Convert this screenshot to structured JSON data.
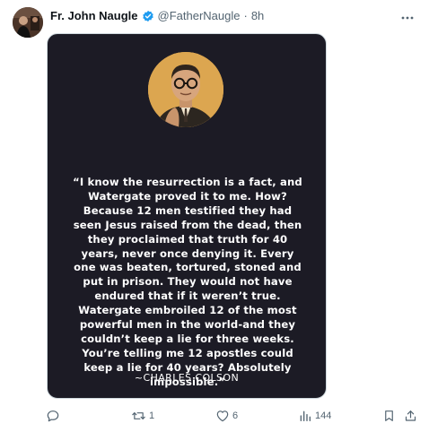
{
  "author": {
    "name": "Fr. John Naugle",
    "handle": "@FatherNaugle",
    "separator": "·",
    "time": "8h"
  },
  "media": {
    "quote": "“I know the resurrection is a fact, and\nWatergate proved it to me. How?\nBecause 12 men testified they had\nseen Jesus raised from the dead, then\nthey proclaimed that truth for 40\nyears, never once denying it. Every\none was beaten, tortured, stoned and\nput in prison. They would not have\nendured that if it weren’t true.\nWatergate embroiled 12 of the most\npowerful men in the world-and they\ncouldn’t keep a lie for three weeks.\nYou’re telling me 12 apostles could\nkeep a lie for 40 years? Absolutely\nimpossible.”",
    "attribution": "~CHARLES COLSON"
  },
  "actions": {
    "reply_count": "",
    "retweet_count": "1",
    "like_count": "6",
    "view_count": "144"
  },
  "icons": {
    "reply": "reply-icon",
    "retweet": "retweet-icon",
    "like": "heart-icon",
    "views": "views-icon",
    "bookmark": "bookmark-icon",
    "share": "share-icon",
    "more": "more-icon",
    "verified": "verified-badge-icon"
  },
  "colors": {
    "text": "#0f1419",
    "secondary": "#536471",
    "verified": "#1d9bf0",
    "card_bg": "#1c1b25",
    "portrait_bg": "#d9a14a"
  }
}
